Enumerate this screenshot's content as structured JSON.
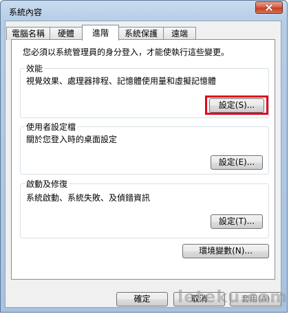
{
  "window": {
    "title": "系統內容"
  },
  "tabs": [
    {
      "label": "電腦名稱"
    },
    {
      "label": "硬體"
    },
    {
      "label": "進階"
    },
    {
      "label": "系統保護"
    },
    {
      "label": "遠端"
    }
  ],
  "active_tab": "進階",
  "panel": {
    "admin_note": "您必須以系統管理員的身分登入，才能使執行這些變更。",
    "performance": {
      "title": "效能",
      "description": "視覺效果、處理器排程、記憶體使用量和虛擬記憶體",
      "button": "設定(S)..."
    },
    "user_profiles": {
      "title": "使用者設定檔",
      "description": "關於您登入時的桌面設定",
      "button": "設定(E)..."
    },
    "startup_recovery": {
      "title": "啟動及修復",
      "description": "系統啟動、系統失敗、及偵錯資訊",
      "button": "設定(T)..."
    },
    "env_button": "環境變數(N)..."
  },
  "footer": {
    "ok": "確定",
    "cancel": "取消",
    "apply": "套用(A)"
  },
  "watermark": "leteku.com"
}
